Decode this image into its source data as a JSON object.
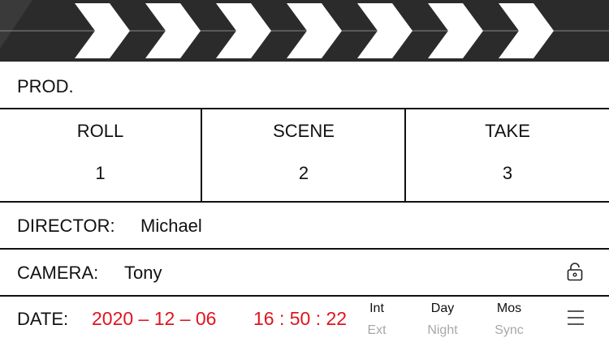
{
  "prod": {
    "label": "PROD.",
    "value": ""
  },
  "roll": {
    "label": "ROLL",
    "value": "1"
  },
  "scene": {
    "label": "SCENE",
    "value": "2"
  },
  "take": {
    "label": "TAKE",
    "value": "3"
  },
  "director": {
    "label": "DIRECTOR:",
    "value": "Michael"
  },
  "camera": {
    "label": "CAMERA:",
    "value": "Tony",
    "lock_icon": "lock-icon"
  },
  "date": {
    "label": "DATE:",
    "date_value": "2020 – 12 – 06",
    "time_value": "16 : 50 : 22",
    "accent": "#e0141e"
  },
  "options": {
    "int_ext": {
      "active": "Int",
      "inactive": "Ext"
    },
    "day_night": {
      "active": "Day",
      "inactive": "Night"
    },
    "mos_sync": {
      "active": "Mos",
      "inactive": "Sync"
    }
  },
  "menu_icon": "hamburger-menu-icon"
}
